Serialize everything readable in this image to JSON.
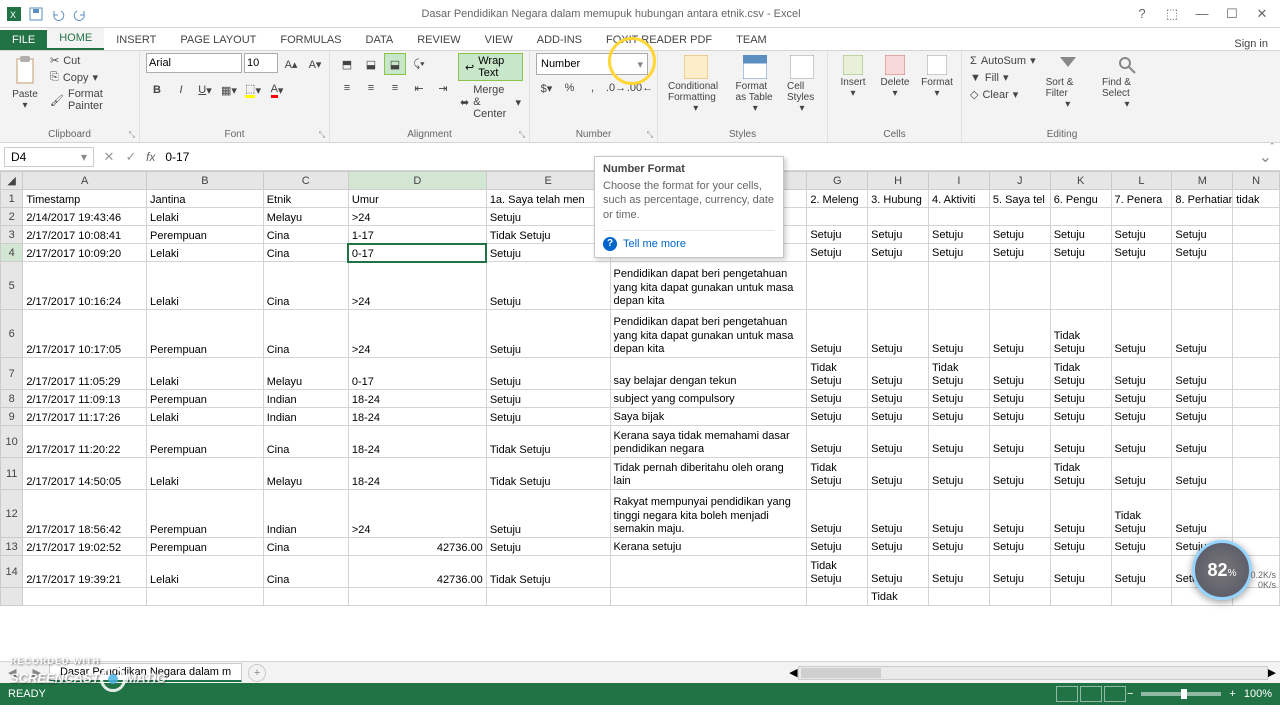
{
  "title": "Dasar Pendidikan Negara dalam memupuk hubungan antara etnik.csv - Excel",
  "qat": [
    "excel",
    "save",
    "undo",
    "redo"
  ],
  "tabs": [
    "FILE",
    "HOME",
    "INSERT",
    "PAGE LAYOUT",
    "FORMULAS",
    "DATA",
    "REVIEW",
    "VIEW",
    "ADD-INS",
    "FOXIT READER PDF",
    "TEAM"
  ],
  "activeTab": "HOME",
  "signin": "Sign in",
  "clipboard": {
    "paste": "Paste",
    "cut": "Cut",
    "copy": "Copy",
    "fp": "Format Painter",
    "label": "Clipboard"
  },
  "font": {
    "name": "Arial",
    "size": "10",
    "label": "Font"
  },
  "alignment": {
    "wrap": "Wrap Text",
    "merge": "Merge & Center",
    "label": "Alignment"
  },
  "number": {
    "format": "Number",
    "label": "Number",
    "inc": "Increase Decimal",
    "dec": "Decrease Decimal"
  },
  "styles": {
    "cond": "Conditional Formatting",
    "fmtas": "Format as Table",
    "cell": "Cell Styles",
    "label": "Styles"
  },
  "cells": {
    "ins": "Insert",
    "del": "Delete",
    "fmt": "Format",
    "label": "Cells"
  },
  "editing": {
    "sum": "AutoSum",
    "fill": "Fill",
    "clear": "Clear",
    "sort": "Sort & Filter",
    "find": "Find & Select",
    "label": "Editing"
  },
  "tooltip": {
    "title": "Number Format",
    "body": "Choose the format for your cells, such as percentage, currency, date or time.",
    "more": "Tell me more"
  },
  "namebox": "D4",
  "formula": "0-17",
  "cols": [
    "A",
    "B",
    "C",
    "D",
    "E",
    "F",
    "G",
    "H",
    "I",
    "J",
    "K",
    "L",
    "M",
    "N"
  ],
  "headers": {
    "A": "Timestamp",
    "B": "Jantina",
    "C": "Etnik",
    "D": "Umur",
    "E": "1a. Saya telah men",
    "G": "2. Meleng",
    "H": "3. Hubung",
    "I": "4. Aktiviti",
    "J": "5. Saya tel",
    "K": "6. Pengu",
    "L": "7. Penera",
    "M": "8. Perhatian",
    "N": "tidak"
  },
  "rows": [
    {
      "n": 2,
      "A": "2/14/2017 19:43:46",
      "B": "Lelaki",
      "C": "Melayu",
      "D": ">24",
      "E": "Setuju",
      "F": "",
      "G": "",
      "H": "",
      "I": "",
      "J": "",
      "K": "",
      "L": "",
      "M": "",
      "N": ""
    },
    {
      "n": 3,
      "A": "2/17/2017 10:08:41",
      "B": "Perempuan",
      "C": "Cina",
      "D": "1-17",
      "E": "Tidak Setuju",
      "F": "",
      "G": "Setuju",
      "H": "Setuju",
      "I": "Setuju",
      "J": "Setuju",
      "K": "Setuju",
      "L": "Setuju",
      "M": "Setuju",
      "N": ""
    },
    {
      "n": 4,
      "A": "2/17/2017 10:09:20",
      "B": "Lelaki",
      "C": "Cina",
      "D": "0-17",
      "E": "Setuju",
      "F": "",
      "G": "Setuju",
      "H": "Setuju",
      "I": "Setuju",
      "J": "Setuju",
      "K": "Setuju",
      "L": "Setuju",
      "M": "Setuju",
      "N": "",
      "sel": true
    },
    {
      "n": 5,
      "A": "2/17/2017 10:16:24",
      "B": "Lelaki",
      "C": "Cina",
      "D": ">24",
      "E": "Setuju",
      "F": "Pendidikan dapat beri pengetahuan yang kita dapat gunakan untuk masa depan kita",
      "G": "",
      "H": "",
      "I": "",
      "J": "",
      "K": "",
      "L": "",
      "M": "",
      "N": "",
      "tall": 3
    },
    {
      "n": 6,
      "A": "2/17/2017 10:17:05",
      "B": "Perempuan",
      "C": "Cina",
      "D": ">24",
      "E": "Setuju",
      "F": "Pendidikan dapat beri pengetahuan yang kita dapat gunakan untuk masa depan kita",
      "G": "Setuju",
      "H": "Setuju",
      "I": "Setuju",
      "J": "Setuju",
      "K": "Tidak Setuju",
      "L": "Setuju",
      "M": "Setuju",
      "N": "",
      "tall": 3
    },
    {
      "n": 7,
      "A": "2/17/2017 11:05:29",
      "B": "Lelaki",
      "C": "Melayu",
      "D": "0-17",
      "E": "Setuju",
      "F": "say belajar dengan tekun",
      "G": "Tidak Setuju",
      "H": "Setuju",
      "I": "Tidak Setuju",
      "J": "Setuju",
      "K": "Tidak Setuju",
      "L": "Setuju",
      "M": "Setuju",
      "N": "",
      "tall": 2
    },
    {
      "n": 8,
      "A": "2/17/2017 11:09:13",
      "B": "Perempuan",
      "C": "Indian",
      "D": "18-24",
      "E": "Setuju",
      "F": "subject yang compulsory",
      "G": "Setuju",
      "H": "Setuju",
      "I": "Setuju",
      "J": "Setuju",
      "K": "Setuju",
      "L": "Setuju",
      "M": "Setuju",
      "N": ""
    },
    {
      "n": 9,
      "A": "2/17/2017 11:17:26",
      "B": "Lelaki",
      "C": "Indian",
      "D": "18-24",
      "E": "Setuju",
      "F": "Saya bijak",
      "G": "Setuju",
      "H": "Setuju",
      "I": "Setuju",
      "J": "Setuju",
      "K": "Setuju",
      "L": "Setuju",
      "M": "Setuju",
      "N": ""
    },
    {
      "n": 10,
      "A": "2/17/2017 11:20:22",
      "B": "Perempuan",
      "C": "Cina",
      "D": "18-24",
      "E": "Tidak Setuju",
      "F": "Kerana saya tidak memahami dasar pendidikan negara",
      "G": "Setuju",
      "H": "Setuju",
      "I": "Setuju",
      "J": "Setuju",
      "K": "Setuju",
      "L": "Setuju",
      "M": "Setuju",
      "N": "",
      "tall": 2
    },
    {
      "n": 11,
      "A": "2/17/2017 14:50:05",
      "B": "Lelaki",
      "C": "Melayu",
      "D": "18-24",
      "E": "Tidak Setuju",
      "F": "Tidak pernah diberitahu oleh orang lain",
      "G": "Tidak Setuju",
      "H": "Setuju",
      "I": "Setuju",
      "J": "Setuju",
      "K": "Tidak Setuju",
      "L": "Setuju",
      "M": "Setuju",
      "N": "",
      "tall": 2
    },
    {
      "n": 12,
      "A": "2/17/2017 18:56:42",
      "B": "Perempuan",
      "C": "Indian",
      "D": ">24",
      "E": "Setuju",
      "F": "Rakyat mempunyai pendidikan yang tinggi negara kita boleh menjadi semakin maju.",
      "G": "Setuju",
      "H": "Setuju",
      "I": "Setuju",
      "J": "Setuju",
      "K": "Setuju",
      "L": "Tidak Setuju",
      "M": "Setuju",
      "N": "",
      "tall": 3
    },
    {
      "n": 13,
      "A": "2/17/2017 19:02:52",
      "B": "Perempuan",
      "C": "Cina",
      "D": "42736.00",
      "E": "Setuju",
      "F": "Kerana setuju",
      "G": "Setuju",
      "H": "Setuju",
      "I": "Setuju",
      "J": "Setuju",
      "K": "Setuju",
      "L": "Setuju",
      "M": "Setuju",
      "N": ""
    },
    {
      "n": 14,
      "A": "2/17/2017 19:39:21",
      "B": "Lelaki",
      "C": "Cina",
      "D": "42736.00",
      "E": "Tidak Setuju",
      "F": "",
      "G": "Tidak Setuju",
      "H": "Setuju",
      "I": "Setuju",
      "J": "Setuju",
      "K": "Setuju",
      "L": "Setuju",
      "M": "Setuju",
      "N": "",
      "tall": 2
    },
    {
      "n": "",
      "A": "",
      "B": "",
      "C": "",
      "D": "",
      "E": "",
      "F": "",
      "G": "",
      "H": "Tidak",
      "I": "",
      "J": "",
      "K": "",
      "L": "",
      "M": "",
      "N": "",
      "tall": 1
    }
  ],
  "sheetname": "Dasar Pendidikan Negara dalam m",
  "status": "READY",
  "zoom": "100%",
  "perf": {
    "val": "82",
    "unit": "%",
    "up": "0.2K/s",
    "dn": "0K/s"
  },
  "watermark": {
    "l1": "RECORDED WITH",
    "l2": "SCREENCAST",
    "l3": "MATIC"
  }
}
